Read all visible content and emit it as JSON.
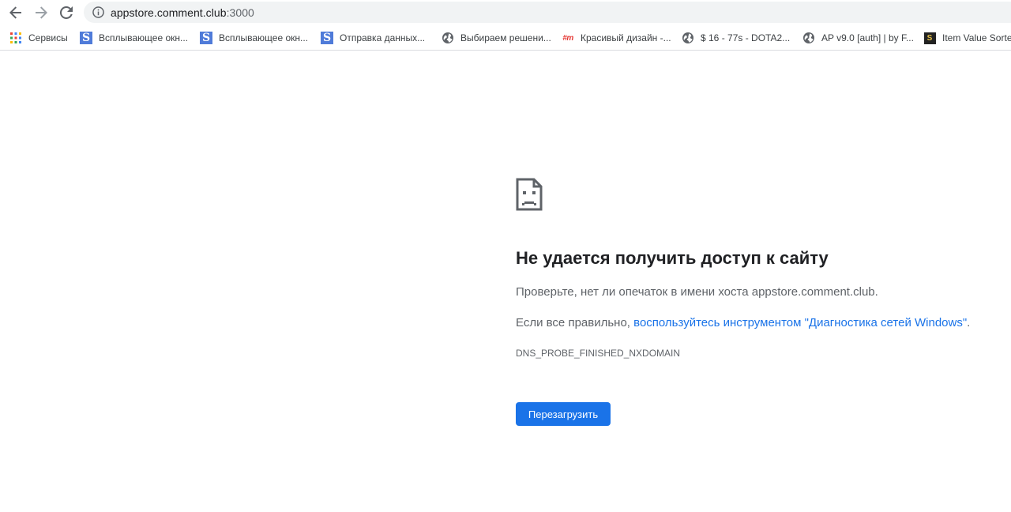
{
  "browser": {
    "address_bar": {
      "url_host": "appstore.comment.club",
      "url_port": ":3000"
    },
    "bookmarks": [
      {
        "label": "Сервисы",
        "icon": "apps-grid-icon"
      },
      {
        "label": "Всплывающее окн...",
        "icon": "s-favicon"
      },
      {
        "label": "Всплывающее окн...",
        "icon": "s-favicon"
      },
      {
        "label": "Отправка данных...",
        "icon": "s-favicon"
      },
      {
        "label": "Выбираем решени...",
        "icon": "globe-icon"
      },
      {
        "label": "Красивый дизайн -...",
        "icon": "m-favicon",
        "icon_text": "#m"
      },
      {
        "label": "$ 16 - 77s - DOTA2...",
        "icon": "globe-icon"
      },
      {
        "label": "AP v9.0 [auth] | by F...",
        "icon": "globe-icon"
      },
      {
        "label": "Item Value Sorter",
        "icon": "item-favicon",
        "icon_text": "S"
      }
    ]
  },
  "error_page": {
    "title": "Не удается получить доступ к сайту",
    "line1": "Проверьте, нет ли опечаток в имени хоста appstore.comment.club.",
    "line2_prefix": "Если все правильно, ",
    "line2_link": "воспользуйтесь инструментом \"Диагностика сетей Windows\"",
    "line2_suffix": ".",
    "error_code": "DNS_PROBE_FINISHED_NXDOMAIN",
    "reload_button": "Перезагрузить"
  },
  "colors": {
    "accent": "#1a73e8",
    "text_primary": "#202124",
    "text_secondary": "#5f6368"
  }
}
